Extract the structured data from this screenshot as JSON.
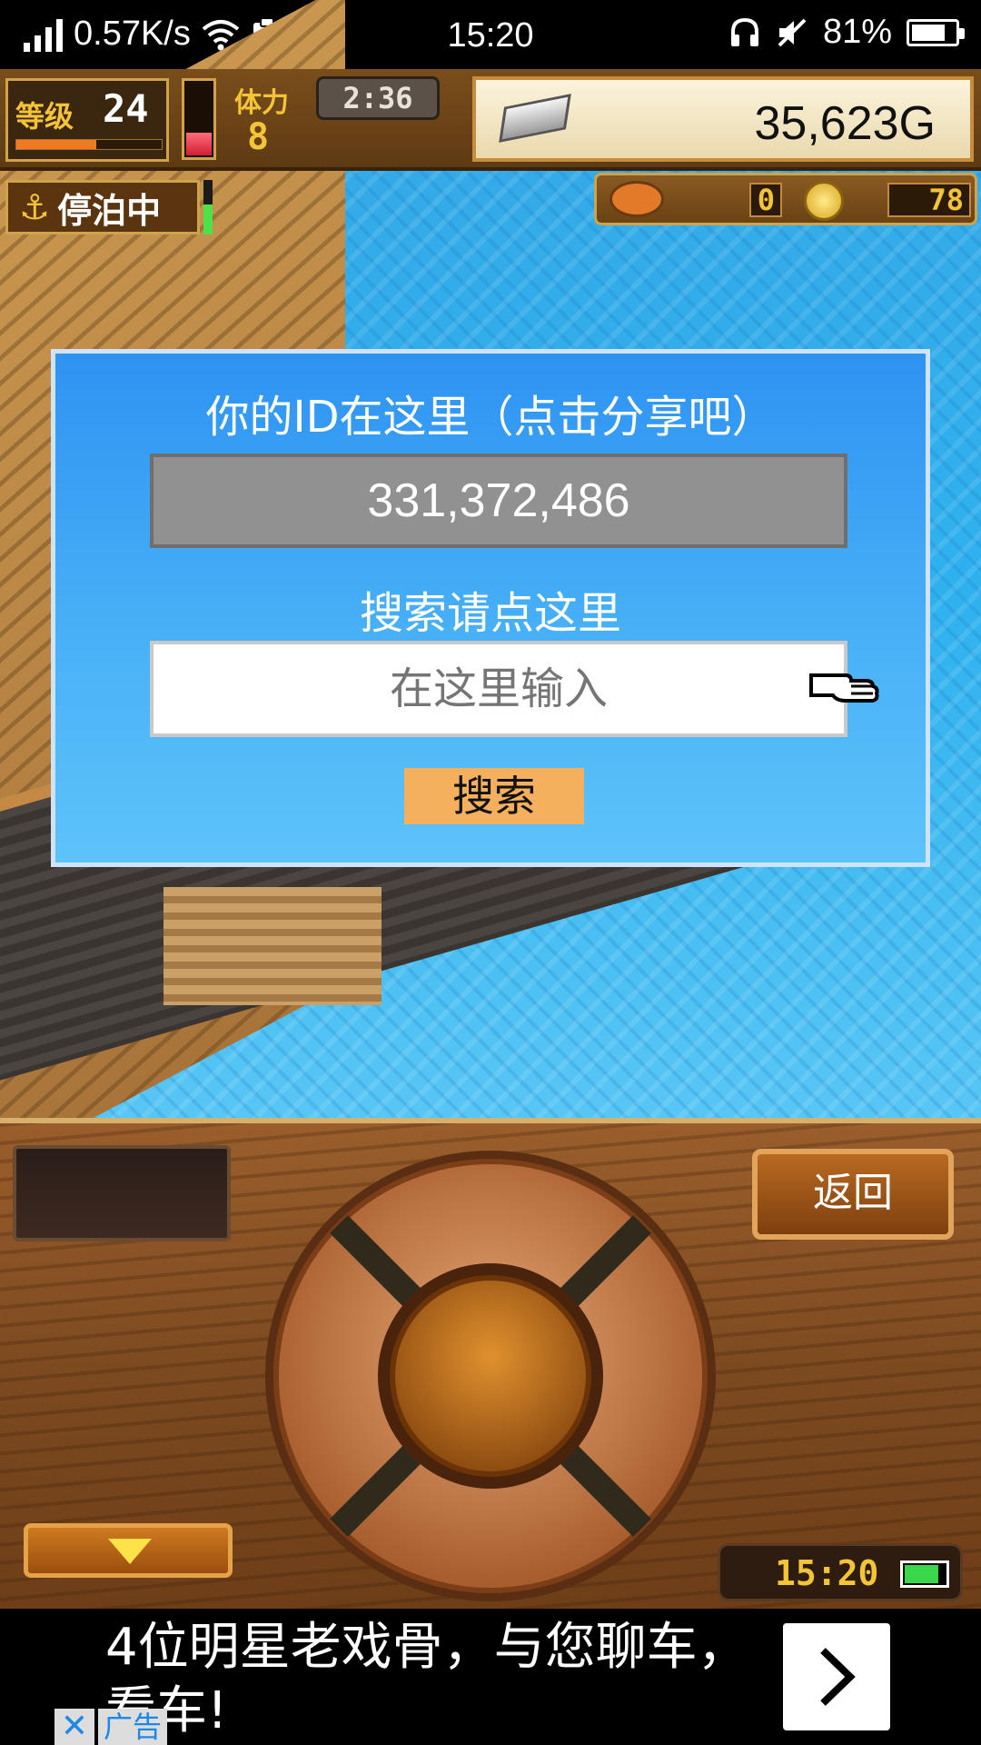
{
  "status_bar": {
    "network_speed": "0.57K/s",
    "time": "15:20",
    "battery_percent": "81%",
    "battery_level": 0.81
  },
  "hud": {
    "level_label": "等级",
    "level_value": "24",
    "level_progress": 0.55,
    "stamina_label": "体力",
    "stamina_value": "8",
    "stamina_fill": 0.35,
    "timer": "2:36",
    "money": "35,623G",
    "status_badge": "停泊中",
    "signal_fill": 0.55,
    "resource_food": "0",
    "resource_coins": "78"
  },
  "dialog": {
    "title": "你的ID在这里（点击分享吧）",
    "id_value": "331,372,486",
    "search_hint": "搜索请点这里",
    "search_placeholder": "在这里输入",
    "search_button": "搜索"
  },
  "panel": {
    "back_button": "返回",
    "clock": "15:20",
    "clock_battery_fill": 0.85
  },
  "ad": {
    "headline": "4位明星老戏骨，与您聊车，看车!",
    "ad_label": "广告",
    "close_symbol": "✕"
  },
  "colors": {
    "dialog_top": "#2e93f2",
    "dialog_bottom": "#5ec3fa",
    "search_button": "#f4b05c",
    "id_box": "#919191",
    "wood": "#7d4a20"
  }
}
